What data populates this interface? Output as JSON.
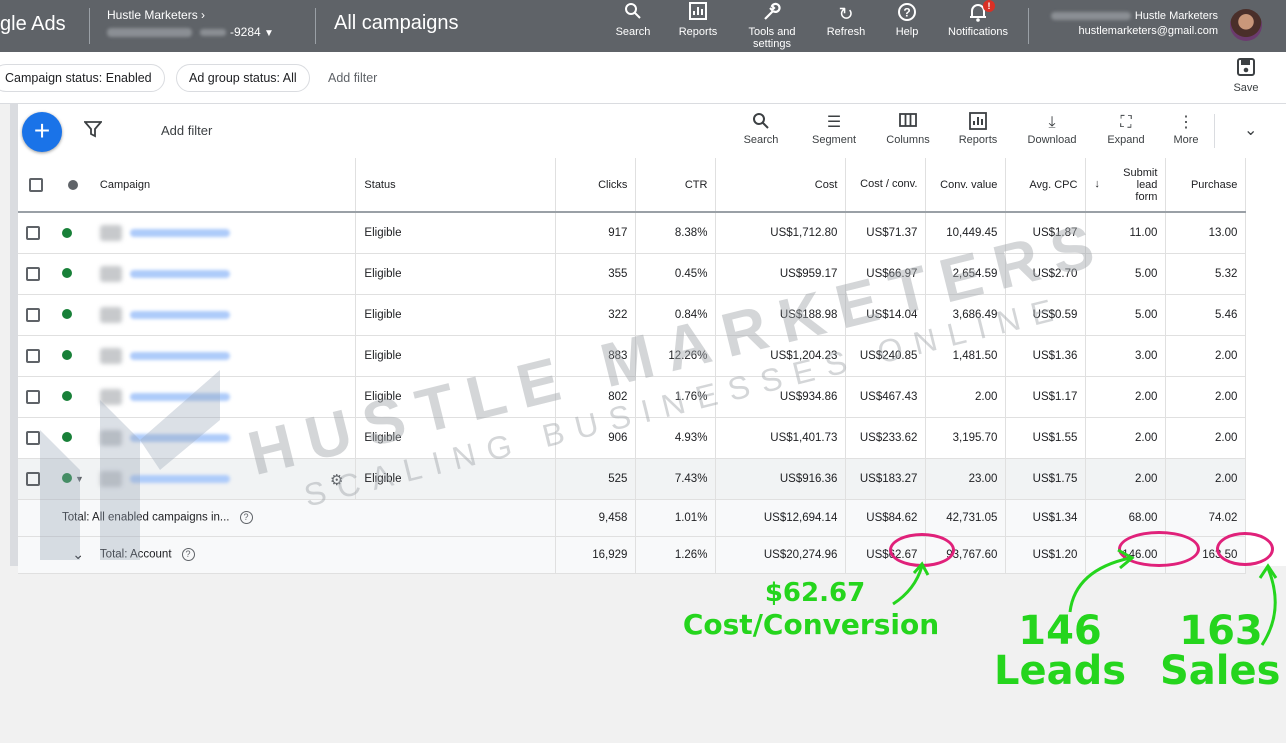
{
  "topbar": {
    "logo": "gle Ads",
    "account_name": "Hustle Marketers",
    "account_id": "9284",
    "page_title": "All campaigns",
    "buttons": [
      {
        "label": "Search",
        "icon": "search-icon"
      },
      {
        "label": "Reports",
        "icon": "reports-icon"
      },
      {
        "label": "Tools and settings",
        "icon": "wrench-icon"
      },
      {
        "label": "Refresh",
        "icon": "refresh-icon"
      },
      {
        "label": "Help",
        "icon": "help-icon"
      },
      {
        "label": "Notifications",
        "icon": "bell-icon"
      }
    ],
    "notif_badge": "!",
    "user_label": "Hustle Marketers",
    "user_email": "hustlemarketers@gmail.com"
  },
  "filters": {
    "chip1": "Campaign status: Enabled",
    "chip2": "Ad group status: All",
    "add_filter": "Add filter",
    "save": "Save"
  },
  "toolbar": {
    "add_filter": "Add filter",
    "tools": [
      "Search",
      "Segment",
      "Columns",
      "Reports",
      "Download",
      "Expand",
      "More"
    ]
  },
  "table": {
    "headers": {
      "campaign": "Campaign",
      "status": "Status",
      "clicks": "Clicks",
      "ctr": "CTR",
      "cost": "Cost",
      "cost_conv": "Cost / conv.",
      "conv_value": "Conv. value",
      "avg_cpc": "Avg. CPC",
      "submit": "Submit lead form",
      "purchase": "Purchase"
    },
    "rows": [
      {
        "status": "Eligible",
        "clicks": "917",
        "ctr": "8.38%",
        "cost": "US$1,712.80",
        "cost_conv": "US$71.37",
        "conv_value": "10,449.45",
        "avg_cpc": "US$1.87",
        "submit": "11.00",
        "purchase": "13.00"
      },
      {
        "status": "Eligible",
        "clicks": "355",
        "ctr": "0.45%",
        "cost": "US$959.17",
        "cost_conv": "US$66.97",
        "conv_value": "2,654.59",
        "avg_cpc": "US$2.70",
        "submit": "5.00",
        "purchase": "5.32"
      },
      {
        "status": "Eligible",
        "clicks": "322",
        "ctr": "0.84%",
        "cost": "US$188.98",
        "cost_conv": "US$14.04",
        "conv_value": "3,686.49",
        "avg_cpc": "US$0.59",
        "submit": "5.00",
        "purchase": "5.46"
      },
      {
        "status": "Eligible",
        "clicks": "883",
        "ctr": "12.26%",
        "cost": "US$1,204.23",
        "cost_conv": "US$240.85",
        "conv_value": "1,481.50",
        "avg_cpc": "US$1.36",
        "submit": "3.00",
        "purchase": "2.00"
      },
      {
        "status": "Eligible",
        "clicks": "802",
        "ctr": "1.76%",
        "cost": "US$934.86",
        "cost_conv": "US$467.43",
        "conv_value": "2.00",
        "avg_cpc": "US$1.17",
        "submit": "2.00",
        "purchase": "2.00"
      },
      {
        "status": "Eligible",
        "clicks": "906",
        "ctr": "4.93%",
        "cost": "US$1,401.73",
        "cost_conv": "US$233.62",
        "conv_value": "3,195.70",
        "avg_cpc": "US$1.55",
        "submit": "2.00",
        "purchase": "2.00"
      },
      {
        "status": "Eligible",
        "clicks": "525",
        "ctr": "7.43%",
        "cost": "US$916.36",
        "cost_conv": "US$183.27",
        "conv_value": "23.00",
        "avg_cpc": "US$1.75",
        "submit": "2.00",
        "purchase": "2.00"
      }
    ],
    "total_enabled": {
      "label": "Total: All enabled campaigns in...",
      "clicks": "9,458",
      "ctr": "1.01%",
      "cost": "US$12,694.14",
      "cost_conv": "US$84.62",
      "conv_value": "42,731.05",
      "avg_cpc": "US$1.34",
      "submit": "68.00",
      "purchase": "74.02"
    },
    "total_account": {
      "label": "Total: Account",
      "clicks": "16,929",
      "ctr": "1.26%",
      "cost": "US$20,274.96",
      "cost_conv": "US$62.67",
      "conv_value": "93,767.60",
      "avg_cpc": "US$1.20",
      "submit": "146.00",
      "purchase": "163.50"
    }
  },
  "watermark": {
    "line1": "HUSTLE MARKETERS",
    "line2": "SCALING BUSINESSES ONLINE"
  },
  "annotations": {
    "cost_value": "$62.67",
    "cost_label": "Cost/Conversion",
    "leads_value": "146",
    "leads_label": "Leads",
    "sales_value": "163",
    "sales_label": "Sales",
    "color_text": "#25d51d",
    "color_circle": "#e0217a"
  },
  "colors": {
    "topbar": "#5f6368",
    "accent": "#1a73e8",
    "status_green": "#188038"
  }
}
